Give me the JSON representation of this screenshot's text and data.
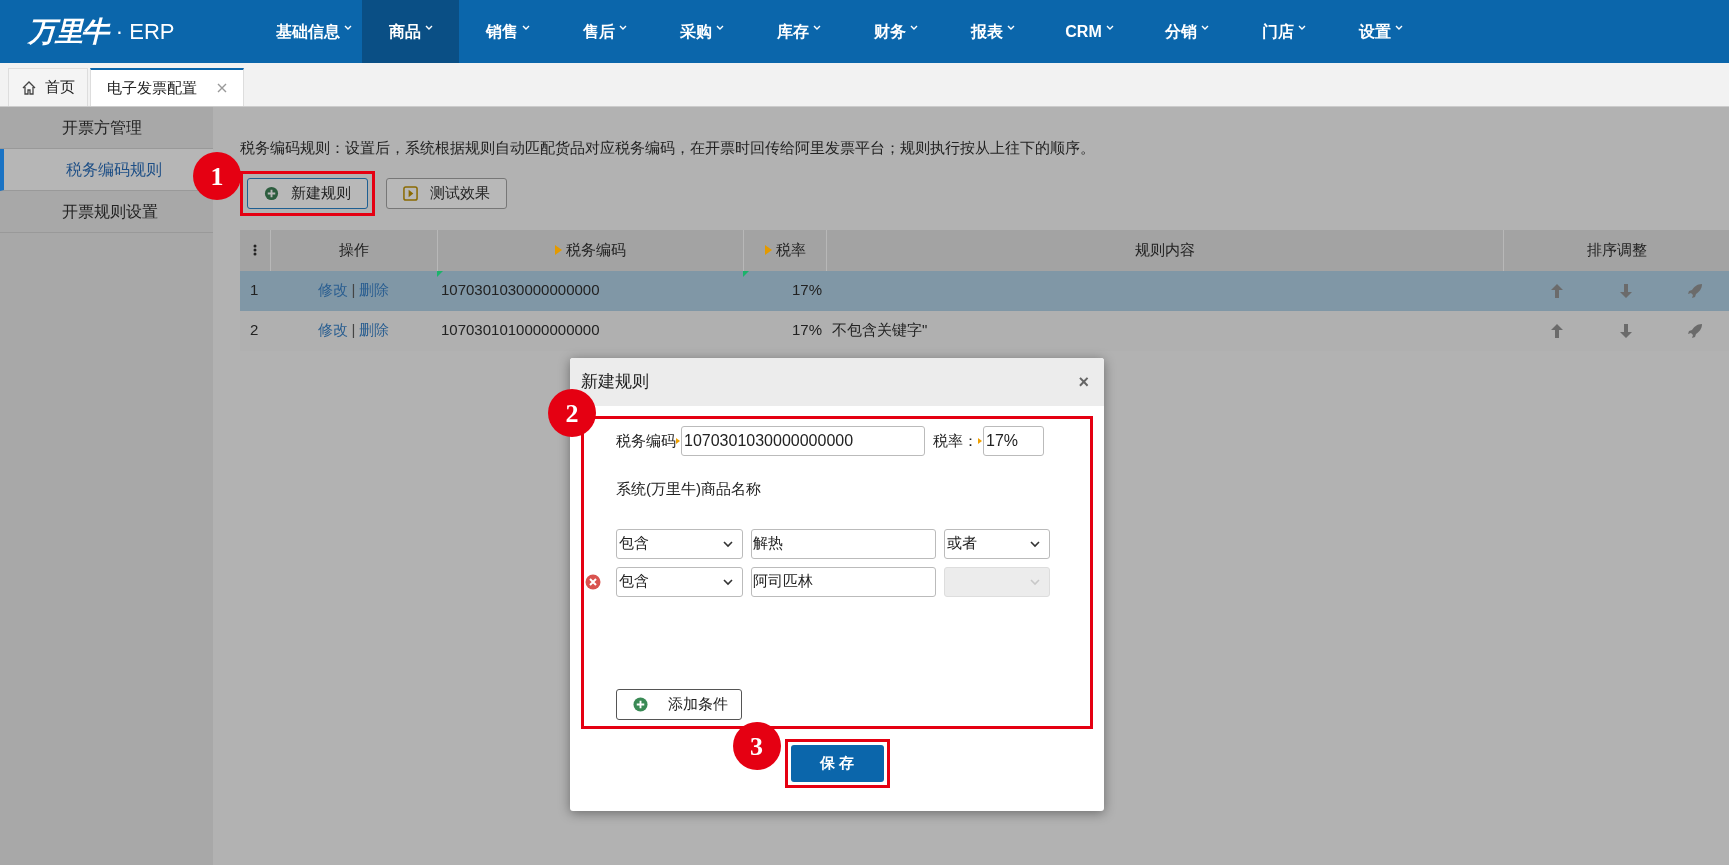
{
  "logo": {
    "brand": "万里牛",
    "separator": "·",
    "product": "ERP"
  },
  "nav": [
    {
      "label": "基础信息",
      "selected": false
    },
    {
      "label": "商品",
      "selected": true
    },
    {
      "label": "销售",
      "selected": false
    },
    {
      "label": "售后",
      "selected": false
    },
    {
      "label": "采购",
      "selected": false
    },
    {
      "label": "库存",
      "selected": false
    },
    {
      "label": "财务",
      "selected": false
    },
    {
      "label": "报表",
      "selected": false
    },
    {
      "label": "CRM",
      "selected": false
    },
    {
      "label": "分销",
      "selected": false
    },
    {
      "label": "门店",
      "selected": false
    },
    {
      "label": "设置",
      "selected": false
    }
  ],
  "page_tabs": [
    {
      "label": "首页",
      "kind": "home",
      "selected": false
    },
    {
      "label": "电子发票配置",
      "kind": "closable",
      "selected": true
    }
  ],
  "sidebar": {
    "items": [
      {
        "label": "开票方管理",
        "selected": false
      },
      {
        "label": "税务编码规则",
        "selected": true
      },
      {
        "label": "开票规则设置",
        "selected": false
      }
    ]
  },
  "description": "税务编码规则：设置后，系统根据规则自动匹配货品对应税务编码，在开票时回传给阿里发票平台；规则执行按从上往下的顺序。",
  "toolbar": [
    {
      "label": "新建规则",
      "kind": "add",
      "highlighted": true,
      "step": "1"
    },
    {
      "label": "测试效果",
      "kind": "test",
      "highlighted": false
    }
  ],
  "table": {
    "columns": [
      {
        "label": "操作",
        "sortable": false
      },
      {
        "label": "税务编码",
        "sortable": true
      },
      {
        "label": "税率",
        "sortable": true
      },
      {
        "label": "规则内容",
        "sortable": false
      },
      {
        "label": "排序调整",
        "sortable": false
      }
    ],
    "rows": [
      {
        "index": "1",
        "edit": "修改",
        "separator": "|",
        "delete": "删除",
        "code": "1070301030000000000",
        "rate": "17%",
        "selected": true,
        "changed": true
      },
      {
        "index": "2",
        "edit": "修改",
        "separator": "|",
        "delete": "删除",
        "code": "1070301010000000000",
        "rate": "17%",
        "content": "不包含关键字\"",
        "selected": false,
        "changed": false
      }
    ]
  },
  "dialog": {
    "title": "新建规则",
    "close": "×",
    "step": "2",
    "code_label": "税务编码",
    "code_value": "1070301030000000000",
    "rate_label": "税率：",
    "rate_value": "17%",
    "section_label": "系统(万里牛)商品名称",
    "conditions": [
      {
        "match": "包含",
        "keyword": "解热",
        "join": "或者",
        "join_disabled": false,
        "removable": false
      },
      {
        "match": "包含",
        "keyword": "阿司匹林",
        "join_disabled": true,
        "removable": true
      }
    ],
    "add_button": "添加条件",
    "save_button": "保 存",
    "save_step": "3"
  }
}
